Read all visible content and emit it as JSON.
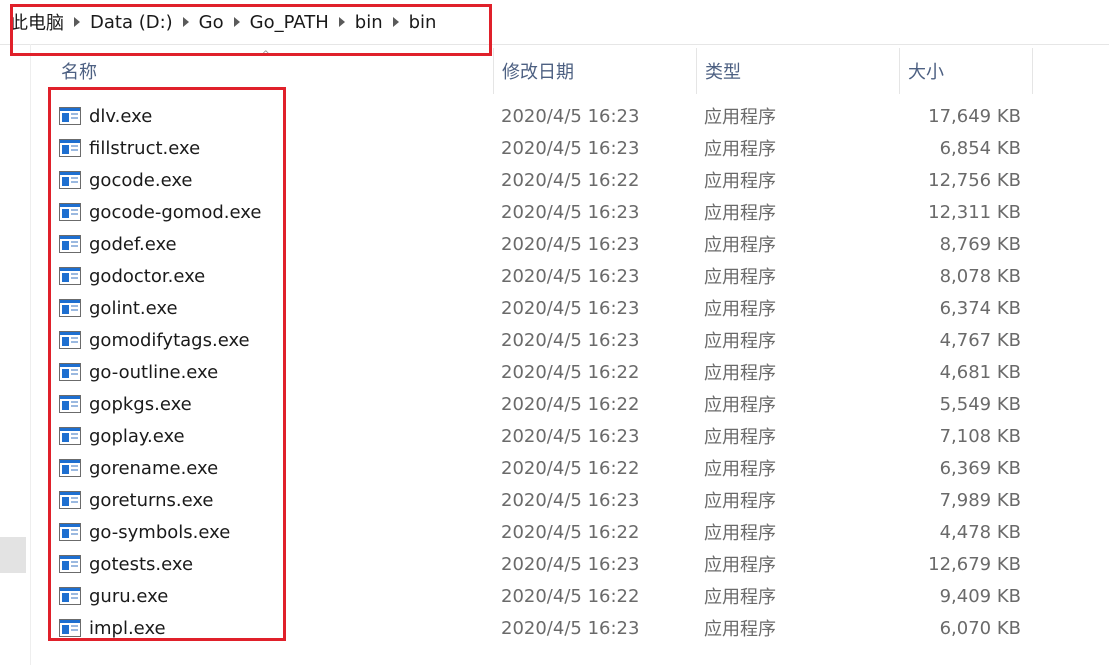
{
  "breadcrumb": {
    "items": [
      {
        "label": "此电脑"
      },
      {
        "label": "Data (D:)"
      },
      {
        "label": "Go"
      },
      {
        "label": "Go_PATH"
      },
      {
        "label": "bin"
      },
      {
        "label": "bin"
      }
    ],
    "separator_icon": "chevron-right-icon"
  },
  "columns": {
    "name": "名称",
    "date": "修改日期",
    "type": "类型",
    "size": "大小"
  },
  "files": [
    {
      "name": "dlv.exe",
      "date": "2020/4/5 16:23",
      "type": "应用程序",
      "size": "17,649 KB"
    },
    {
      "name": "fillstruct.exe",
      "date": "2020/4/5 16:23",
      "type": "应用程序",
      "size": "6,854 KB"
    },
    {
      "name": "gocode.exe",
      "date": "2020/4/5 16:22",
      "type": "应用程序",
      "size": "12,756 KB"
    },
    {
      "name": "gocode-gomod.exe",
      "date": "2020/4/5 16:23",
      "type": "应用程序",
      "size": "12,311 KB"
    },
    {
      "name": "godef.exe",
      "date": "2020/4/5 16:23",
      "type": "应用程序",
      "size": "8,769 KB"
    },
    {
      "name": "godoctor.exe",
      "date": "2020/4/5 16:23",
      "type": "应用程序",
      "size": "8,078 KB"
    },
    {
      "name": "golint.exe",
      "date": "2020/4/5 16:23",
      "type": "应用程序",
      "size": "6,374 KB"
    },
    {
      "name": "gomodifytags.exe",
      "date": "2020/4/5 16:23",
      "type": "应用程序",
      "size": "4,767 KB"
    },
    {
      "name": "go-outline.exe",
      "date": "2020/4/5 16:22",
      "type": "应用程序",
      "size": "4,681 KB"
    },
    {
      "name": "gopkgs.exe",
      "date": "2020/4/5 16:22",
      "type": "应用程序",
      "size": "5,549 KB"
    },
    {
      "name": "goplay.exe",
      "date": "2020/4/5 16:23",
      "type": "应用程序",
      "size": "7,108 KB"
    },
    {
      "name": "gorename.exe",
      "date": "2020/4/5 16:22",
      "type": "应用程序",
      "size": "6,369 KB"
    },
    {
      "name": "goreturns.exe",
      "date": "2020/4/5 16:23",
      "type": "应用程序",
      "size": "7,989 KB"
    },
    {
      "name": "go-symbols.exe",
      "date": "2020/4/5 16:22",
      "type": "应用程序",
      "size": "4,478 KB"
    },
    {
      "name": "gotests.exe",
      "date": "2020/4/5 16:23",
      "type": "应用程序",
      "size": "12,679 KB"
    },
    {
      "name": "guru.exe",
      "date": "2020/4/5 16:22",
      "type": "应用程序",
      "size": "9,409 KB"
    },
    {
      "name": "impl.exe",
      "date": "2020/4/5 16:23",
      "type": "应用程序",
      "size": "6,070 KB"
    }
  ],
  "file_icon": "application-exe-icon",
  "colors": {
    "annotation": "#e0202a",
    "header_text": "#4d6082",
    "icon_blue": "#1e6fd0"
  }
}
